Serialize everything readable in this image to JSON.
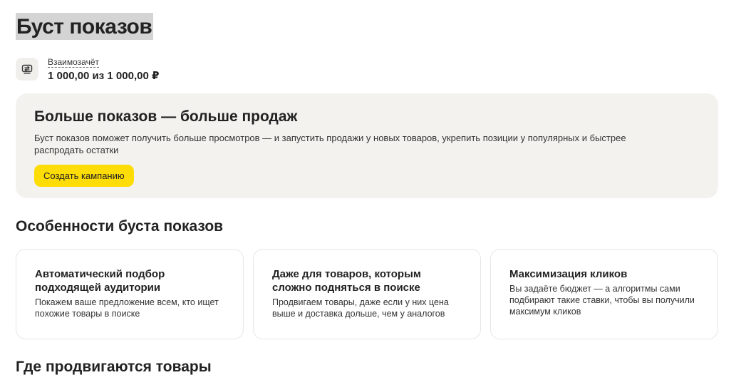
{
  "page": {
    "title": "Буст показов"
  },
  "offset": {
    "icon": "mutual-offset-icon",
    "label": "Взаимозачёт",
    "value": "1 000,00 из 1 000,00 ₽"
  },
  "promo": {
    "title": "Больше показов — больше продаж",
    "description": "Буст показов поможет получить больше просмотров — и запустить продажи у новых товаров, укрепить позиции у популярных и быстрее распродать остатки",
    "button_label": "Создать кампанию"
  },
  "features": {
    "title": "Особенности буста показов",
    "cards": [
      {
        "title": "Автоматический подбор подходящей аудитории",
        "description": "Покажем ваше предложение всем, кто ищет похожие товары в поиске"
      },
      {
        "title": "Даже для товаров, которым сложно подняться в поиске",
        "description": "Продвигаем товары, даже если у них цена выше и доставка дольше, чем у аналогов"
      },
      {
        "title": "Максимизация кликов",
        "description": "Вы задаёте бюджет — а алгоритмы сами подбирают такие ставки, чтобы вы получили максимум кликов"
      }
    ]
  },
  "where": {
    "title": "Где продвигаются товары"
  },
  "colors": {
    "accent": "#fedc05",
    "promo_bg": "#f3f2ef",
    "title_highlight": "#d4d4d4"
  }
}
